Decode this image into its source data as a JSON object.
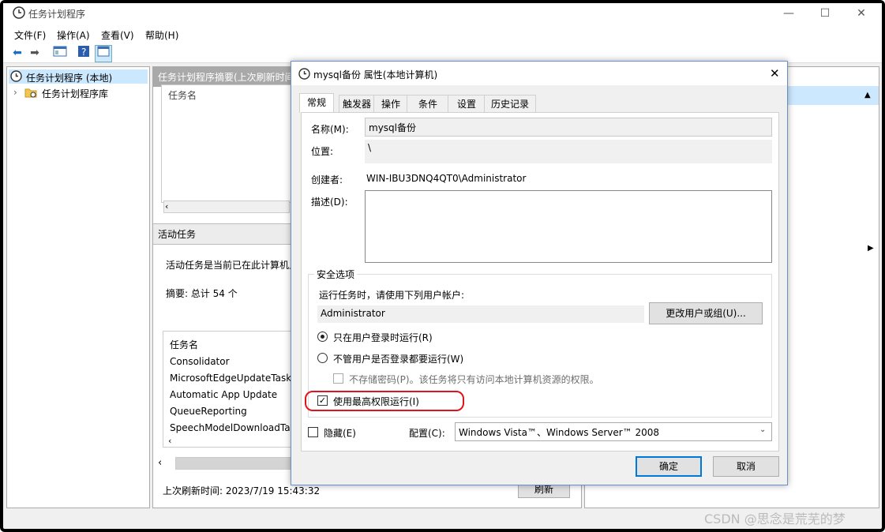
{
  "window": {
    "title": "任务计划程序",
    "minimize": "—",
    "maximize": "☐",
    "close": "✕"
  },
  "menu": [
    "文件(F)",
    "操作(A)",
    "查看(V)",
    "帮助(H)"
  ],
  "tree": {
    "root": "任务计划程序 (本地)",
    "library": "任务计划程序库"
  },
  "center": {
    "summary_header": "任务计划程序摘要(上次刷新时间",
    "summary_partial": "任务名",
    "active_header": "活动任务",
    "active_desc": "活动任务是当前已在此计算机上",
    "summary_count": "摘要: 总计 54 个",
    "list_header": "任务名",
    "tasks": [
      "Consolidator",
      "MicrosoftEdgeUpdateTask",
      "Automatic App Update",
      "QueueReporting",
      "SpeechModelDownloadTa"
    ],
    "last_refresh": "上次刷新时间: 2023/7/19 15:43:32",
    "refresh_btn": "刷新"
  },
  "dialog": {
    "title": "mysql备份 属性(本地计算机)",
    "close": "✕",
    "tabs": [
      "常规",
      "触发器",
      "操作",
      "条件",
      "设置",
      "历史记录"
    ],
    "name_label": "名称(M):",
    "name_value": "mysql备份",
    "location_label": "位置:",
    "location_value": "\\",
    "author_label": "创建者:",
    "author_value": "WIN-IBU3DNQ4QT0\\Administrator",
    "desc_label": "描述(D):",
    "desc_value": "",
    "security_group": "安全选项",
    "run_as_prompt": "运行任务时，请使用下列用户帐户:",
    "user_account": "Administrator",
    "change_user_btn": "更改用户或组(U)...",
    "radio_logged_on": "只在用户登录时运行(R)",
    "radio_whether": "不管用户是否登录都要运行(W)",
    "no_store_pwd": "不存储密码(P)。该任务将只有访问本地计算机资源的权限。",
    "highest_priv": "使用最高权限运行(I)",
    "hidden_label": "隐藏(E)",
    "config_label": "配置(C):",
    "config_value": "Windows Vista™、Windows Server™ 2008",
    "ok": "确定",
    "cancel": "取消"
  },
  "watermark": "CSDN @思念是荒芜的梦",
  "colors": {
    "highlight": "#e0141e",
    "selection": "#cce8ff",
    "header_gray": "#a9a9a9",
    "ok_border": "#0078d7"
  }
}
